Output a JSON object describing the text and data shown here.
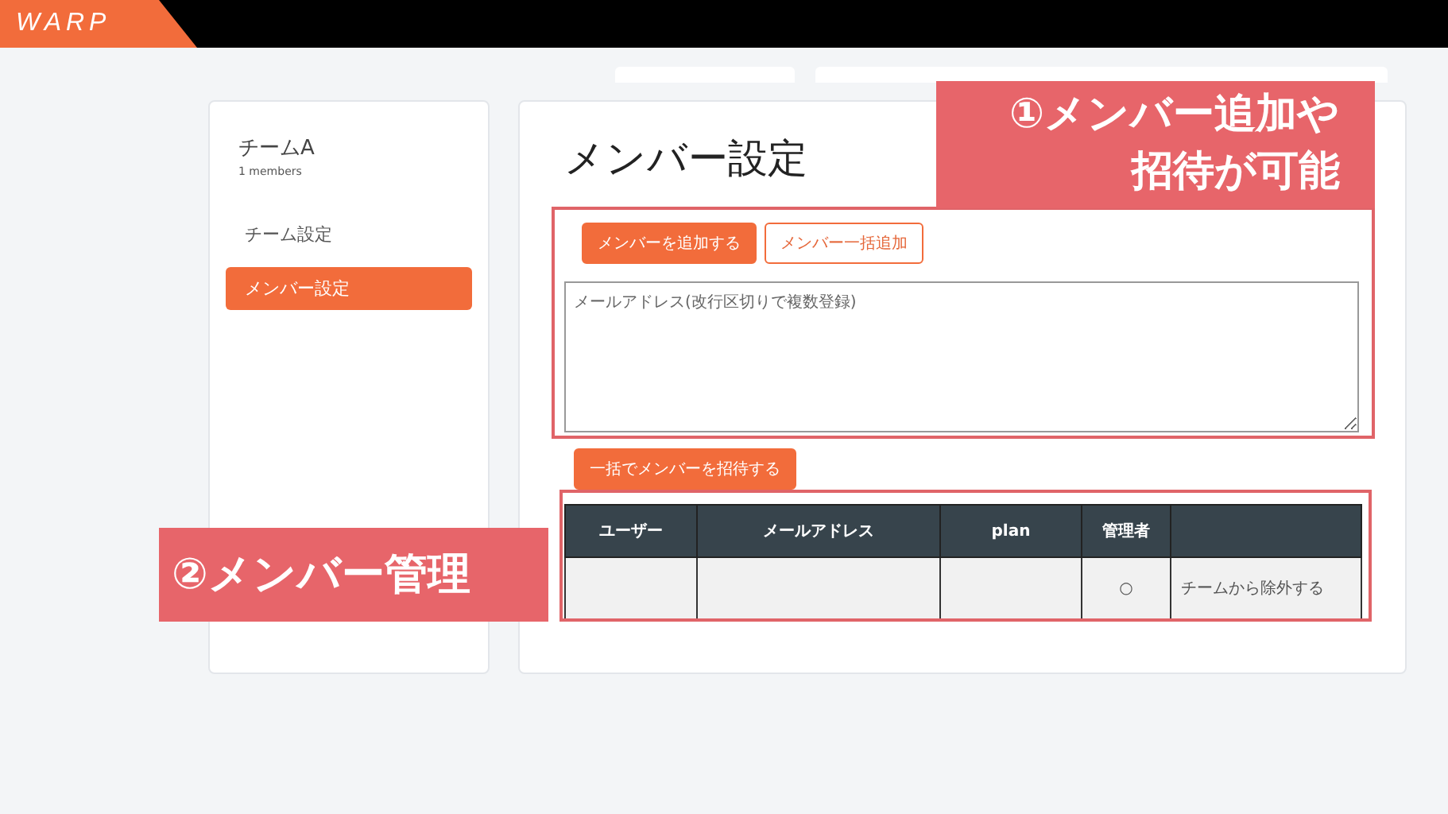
{
  "header": {
    "logo": "WARP"
  },
  "sidebar": {
    "team_name": "チームA",
    "member_count": "1 members",
    "items": [
      {
        "label": "チーム設定",
        "selected": false
      },
      {
        "label": "メンバー設定",
        "selected": true
      }
    ]
  },
  "main": {
    "title": "メンバー設定",
    "mode_buttons": [
      {
        "label": "メンバーを追加する",
        "selected": true
      },
      {
        "label": "メンバー一括追加",
        "selected": false
      }
    ],
    "email_field": {
      "placeholder": "メールアドレス(改行区切りで複数登録)"
    },
    "invite_button": "一括でメンバーを招待する",
    "table": {
      "columns": [
        "ユーザー",
        "メールアドレス",
        "plan",
        "管理者"
      ],
      "rows": [
        {
          "admin": "○",
          "action": "チームから除外する"
        }
      ]
    }
  },
  "callouts": [
    {
      "number": "①",
      "text": "メンバー追加や",
      "text_2": "招待が可能"
    },
    {
      "number": "②",
      "text": "メンバー管理"
    }
  ]
}
